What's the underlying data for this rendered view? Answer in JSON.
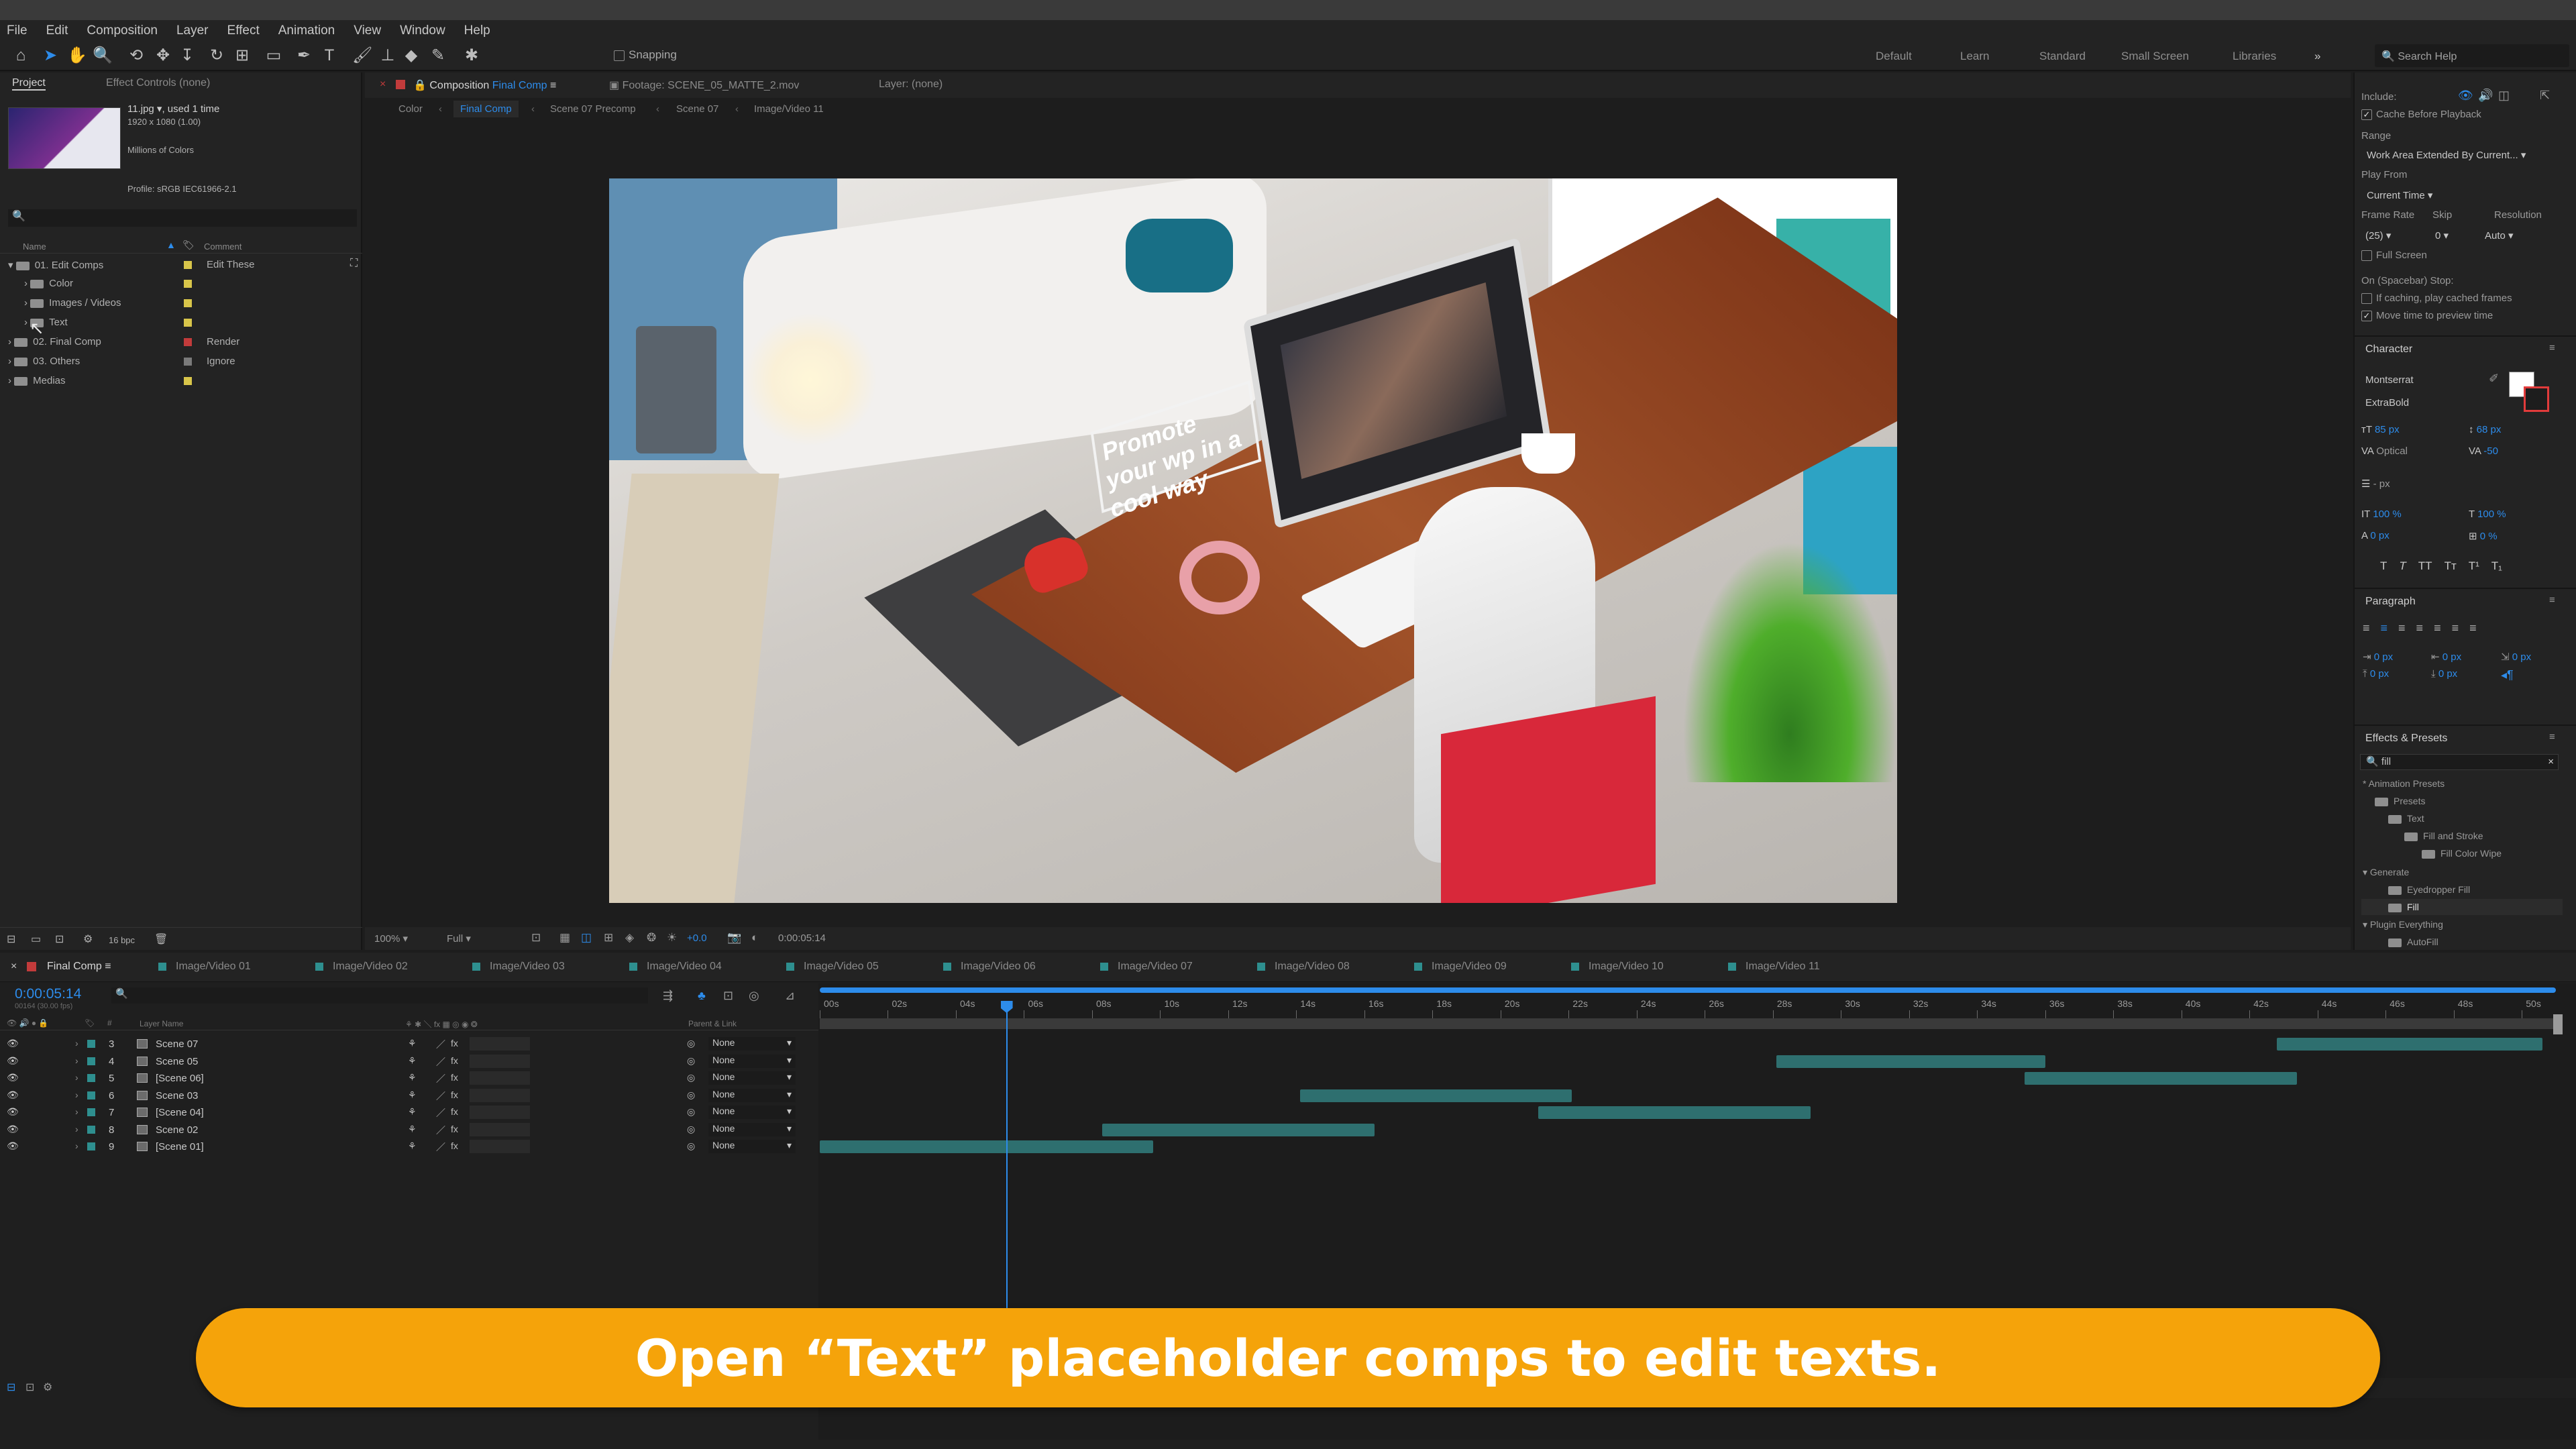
{
  "menu": [
    "File",
    "Edit",
    "Composition",
    "Layer",
    "Effect",
    "Animation",
    "View",
    "Window",
    "Help"
  ],
  "toolbar": {
    "snapping": "Snapping",
    "search_placeholder": "Search Help"
  },
  "workspaces": [
    "Default",
    "Learn",
    "Standard",
    "Small Screen",
    "Libraries"
  ],
  "project": {
    "tab_project": "Project",
    "tab_effect_controls": "Effect Controls (none)",
    "file_name": "11.jpg",
    "used": ", used 1 time",
    "dimensions": "1920 x 1080 (1.00)",
    "colors": "Millions of Colors",
    "profile": "Profile: sRGB IEC61966-2.1",
    "col_name": "Name",
    "col_comment": "Comment",
    "bpc": "16 bpc",
    "items": [
      {
        "label": "01. Edit Comps",
        "comment": "Edit These",
        "color": "#d8c54a"
      },
      {
        "label": "Color",
        "comment": "",
        "color": "#d8c54a"
      },
      {
        "label": "Images / Videos",
        "comment": "",
        "color": "#d8c54a"
      },
      {
        "label": "Text",
        "comment": "",
        "color": "#d8c54a"
      },
      {
        "label": "02. Final Comp",
        "comment": "Render",
        "color": "#c23b3b"
      },
      {
        "label": "03. Others",
        "comment": "Ignore",
        "color": "#7a7a7a"
      },
      {
        "label": "Medias",
        "comment": "",
        "color": "#d8c54a"
      }
    ]
  },
  "viewer": {
    "tab_composition": "Composition",
    "comp_name": "Final Comp",
    "tab_footage": "Footage: SCENE_05_MATTE_2.mov",
    "tab_layer": "Layer: (none)",
    "breadcrumbs": [
      "Color",
      "Final Comp",
      "Scene 07 Precomp",
      "Scene 07",
      "Image/Video 11"
    ],
    "zoom": "100%",
    "resolution": "Full",
    "exposure": "+0.0",
    "timecode": "0:00:05:14",
    "scene_sign_text": "Promote your wp in a cool way"
  },
  "timeline": {
    "comp_tab": "Final Comp",
    "tabs": [
      "Image/Video 01",
      "Image/Video 02",
      "Image/Video 03",
      "Image/Video 04",
      "Image/Video 05",
      "Image/Video 06",
      "Image/Video 07",
      "Image/Video 08",
      "Image/Video 09",
      "Image/Video 10",
      "Image/Video 11"
    ],
    "timecode": "0:00:05:14",
    "fps": "00164 (30.00 fps)",
    "col_layer_name": "Layer Name",
    "col_parent": "Parent & Link",
    "ruler": [
      "00s",
      "02s",
      "04s",
      "06s",
      "08s",
      "10s",
      "12s",
      "14s",
      "16s",
      "18s",
      "20s",
      "22s",
      "24s",
      "26s",
      "28s",
      "30s",
      "32s",
      "34s",
      "36s",
      "38s",
      "40s",
      "42s",
      "44s",
      "46s",
      "48s",
      "50s"
    ],
    "layers": [
      {
        "num": "3",
        "name": "Scene 07",
        "parent": "None",
        "start": 42.8,
        "end": 50.6
      },
      {
        "num": "4",
        "name": "Scene 05",
        "parent": "None",
        "start": 28.1,
        "end": 36.0
      },
      {
        "num": "5",
        "name": "[Scene 06]",
        "parent": "None",
        "start": 35.4,
        "end": 43.4
      },
      {
        "num": "6",
        "name": "Scene 03",
        "parent": "None",
        "start": 14.1,
        "end": 22.1
      },
      {
        "num": "7",
        "name": "[Scene 04]",
        "parent": "None",
        "start": 21.1,
        "end": 29.1
      },
      {
        "num": "8",
        "name": "Scene 02",
        "parent": "None",
        "start": 8.3,
        "end": 16.3
      },
      {
        "num": "9",
        "name": "[Scene 01]",
        "parent": "None",
        "start": 0.0,
        "end": 9.8
      }
    ],
    "playhead_seconds": 5.47,
    "duration_seconds": 51
  },
  "preview": {
    "include": "Include:",
    "cache": "Cache Before Playback",
    "range": "Range",
    "range_value": "Work Area Extended By Current...",
    "play_from": "Play From",
    "play_from_value": "Current Time",
    "frame_rate": "Frame Rate",
    "skip": "Skip",
    "resolution": "Resolution",
    "frame_rate_value": "(25)",
    "skip_value": "0",
    "resolution_value": "Auto",
    "full_screen": "Full Screen",
    "on_stop": "On (Spacebar) Stop:",
    "if_caching": "If caching, play cached frames",
    "move_time": "Move time to preview time"
  },
  "character": {
    "title": "Character",
    "font": "Montserrat",
    "weight": "ExtraBold",
    "size": "85 px",
    "leading": "68 px",
    "kerning": "Optical",
    "tracking": "-50",
    "stroke": "- px",
    "v_scale": "100 %",
    "h_scale": "100 %",
    "baseline": "0 px",
    "tsume": "0 %",
    "styles": [
      "T",
      "T",
      "TT",
      "Tт",
      "T¹",
      "T₁"
    ]
  },
  "paragraph": {
    "title": "Paragraph",
    "indent_values": [
      "0 px",
      "0 px",
      "0 px",
      "0 px",
      "0 px"
    ]
  },
  "effects": {
    "title": "Effects & Presets",
    "search": "fill",
    "tree": [
      {
        "label": "* Animation Presets",
        "depth": 0
      },
      {
        "label": "Presets",
        "depth": 1
      },
      {
        "label": "Text",
        "depth": 2
      },
      {
        "label": "Fill and Stroke",
        "depth": 3
      },
      {
        "label": "Fill Color Wipe",
        "depth": 4
      },
      {
        "label": "Generate",
        "depth": 0
      },
      {
        "label": "Eyedropper Fill",
        "depth": 1
      },
      {
        "label": "Fill",
        "depth": 1
      },
      {
        "label": "Plugin Everything",
        "depth": 0
      },
      {
        "label": "AutoFill",
        "depth": 1
      }
    ]
  },
  "caption": "Open “Text” placeholder comps to edit texts.",
  "colors": {
    "accent": "#f5a30a",
    "teal_bar": "#2e6f6f",
    "blue_ui": "#2d8ceb"
  }
}
